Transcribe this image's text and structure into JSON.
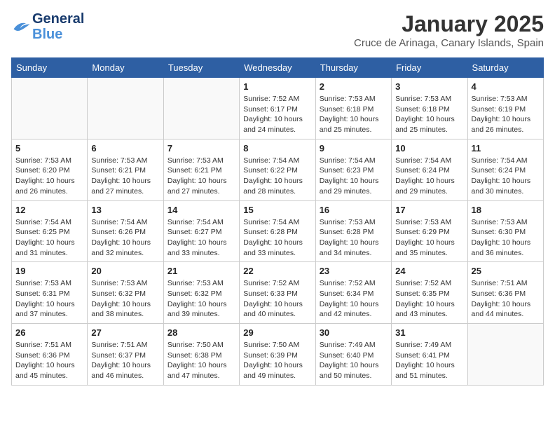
{
  "header": {
    "logo_line1": "General",
    "logo_line2": "Blue",
    "month": "January 2025",
    "location": "Cruce de Arinaga, Canary Islands, Spain"
  },
  "days_of_week": [
    "Sunday",
    "Monday",
    "Tuesday",
    "Wednesday",
    "Thursday",
    "Friday",
    "Saturday"
  ],
  "weeks": [
    [
      {
        "day": "",
        "info": ""
      },
      {
        "day": "",
        "info": ""
      },
      {
        "day": "",
        "info": ""
      },
      {
        "day": "1",
        "info": "Sunrise: 7:52 AM\nSunset: 6:17 PM\nDaylight: 10 hours\nand 24 minutes."
      },
      {
        "day": "2",
        "info": "Sunrise: 7:53 AM\nSunset: 6:18 PM\nDaylight: 10 hours\nand 25 minutes."
      },
      {
        "day": "3",
        "info": "Sunrise: 7:53 AM\nSunset: 6:18 PM\nDaylight: 10 hours\nand 25 minutes."
      },
      {
        "day": "4",
        "info": "Sunrise: 7:53 AM\nSunset: 6:19 PM\nDaylight: 10 hours\nand 26 minutes."
      }
    ],
    [
      {
        "day": "5",
        "info": "Sunrise: 7:53 AM\nSunset: 6:20 PM\nDaylight: 10 hours\nand 26 minutes."
      },
      {
        "day": "6",
        "info": "Sunrise: 7:53 AM\nSunset: 6:21 PM\nDaylight: 10 hours\nand 27 minutes."
      },
      {
        "day": "7",
        "info": "Sunrise: 7:53 AM\nSunset: 6:21 PM\nDaylight: 10 hours\nand 27 minutes."
      },
      {
        "day": "8",
        "info": "Sunrise: 7:54 AM\nSunset: 6:22 PM\nDaylight: 10 hours\nand 28 minutes."
      },
      {
        "day": "9",
        "info": "Sunrise: 7:54 AM\nSunset: 6:23 PM\nDaylight: 10 hours\nand 29 minutes."
      },
      {
        "day": "10",
        "info": "Sunrise: 7:54 AM\nSunset: 6:24 PM\nDaylight: 10 hours\nand 29 minutes."
      },
      {
        "day": "11",
        "info": "Sunrise: 7:54 AM\nSunset: 6:24 PM\nDaylight: 10 hours\nand 30 minutes."
      }
    ],
    [
      {
        "day": "12",
        "info": "Sunrise: 7:54 AM\nSunset: 6:25 PM\nDaylight: 10 hours\nand 31 minutes."
      },
      {
        "day": "13",
        "info": "Sunrise: 7:54 AM\nSunset: 6:26 PM\nDaylight: 10 hours\nand 32 minutes."
      },
      {
        "day": "14",
        "info": "Sunrise: 7:54 AM\nSunset: 6:27 PM\nDaylight: 10 hours\nand 33 minutes."
      },
      {
        "day": "15",
        "info": "Sunrise: 7:54 AM\nSunset: 6:28 PM\nDaylight: 10 hours\nand 33 minutes."
      },
      {
        "day": "16",
        "info": "Sunrise: 7:53 AM\nSunset: 6:28 PM\nDaylight: 10 hours\nand 34 minutes."
      },
      {
        "day": "17",
        "info": "Sunrise: 7:53 AM\nSunset: 6:29 PM\nDaylight: 10 hours\nand 35 minutes."
      },
      {
        "day": "18",
        "info": "Sunrise: 7:53 AM\nSunset: 6:30 PM\nDaylight: 10 hours\nand 36 minutes."
      }
    ],
    [
      {
        "day": "19",
        "info": "Sunrise: 7:53 AM\nSunset: 6:31 PM\nDaylight: 10 hours\nand 37 minutes."
      },
      {
        "day": "20",
        "info": "Sunrise: 7:53 AM\nSunset: 6:32 PM\nDaylight: 10 hours\nand 38 minutes."
      },
      {
        "day": "21",
        "info": "Sunrise: 7:53 AM\nSunset: 6:32 PM\nDaylight: 10 hours\nand 39 minutes."
      },
      {
        "day": "22",
        "info": "Sunrise: 7:52 AM\nSunset: 6:33 PM\nDaylight: 10 hours\nand 40 minutes."
      },
      {
        "day": "23",
        "info": "Sunrise: 7:52 AM\nSunset: 6:34 PM\nDaylight: 10 hours\nand 42 minutes."
      },
      {
        "day": "24",
        "info": "Sunrise: 7:52 AM\nSunset: 6:35 PM\nDaylight: 10 hours\nand 43 minutes."
      },
      {
        "day": "25",
        "info": "Sunrise: 7:51 AM\nSunset: 6:36 PM\nDaylight: 10 hours\nand 44 minutes."
      }
    ],
    [
      {
        "day": "26",
        "info": "Sunrise: 7:51 AM\nSunset: 6:36 PM\nDaylight: 10 hours\nand 45 minutes."
      },
      {
        "day": "27",
        "info": "Sunrise: 7:51 AM\nSunset: 6:37 PM\nDaylight: 10 hours\nand 46 minutes."
      },
      {
        "day": "28",
        "info": "Sunrise: 7:50 AM\nSunset: 6:38 PM\nDaylight: 10 hours\nand 47 minutes."
      },
      {
        "day": "29",
        "info": "Sunrise: 7:50 AM\nSunset: 6:39 PM\nDaylight: 10 hours\nand 49 minutes."
      },
      {
        "day": "30",
        "info": "Sunrise: 7:49 AM\nSunset: 6:40 PM\nDaylight: 10 hours\nand 50 minutes."
      },
      {
        "day": "31",
        "info": "Sunrise: 7:49 AM\nSunset: 6:41 PM\nDaylight: 10 hours\nand 51 minutes."
      },
      {
        "day": "",
        "info": ""
      }
    ]
  ]
}
